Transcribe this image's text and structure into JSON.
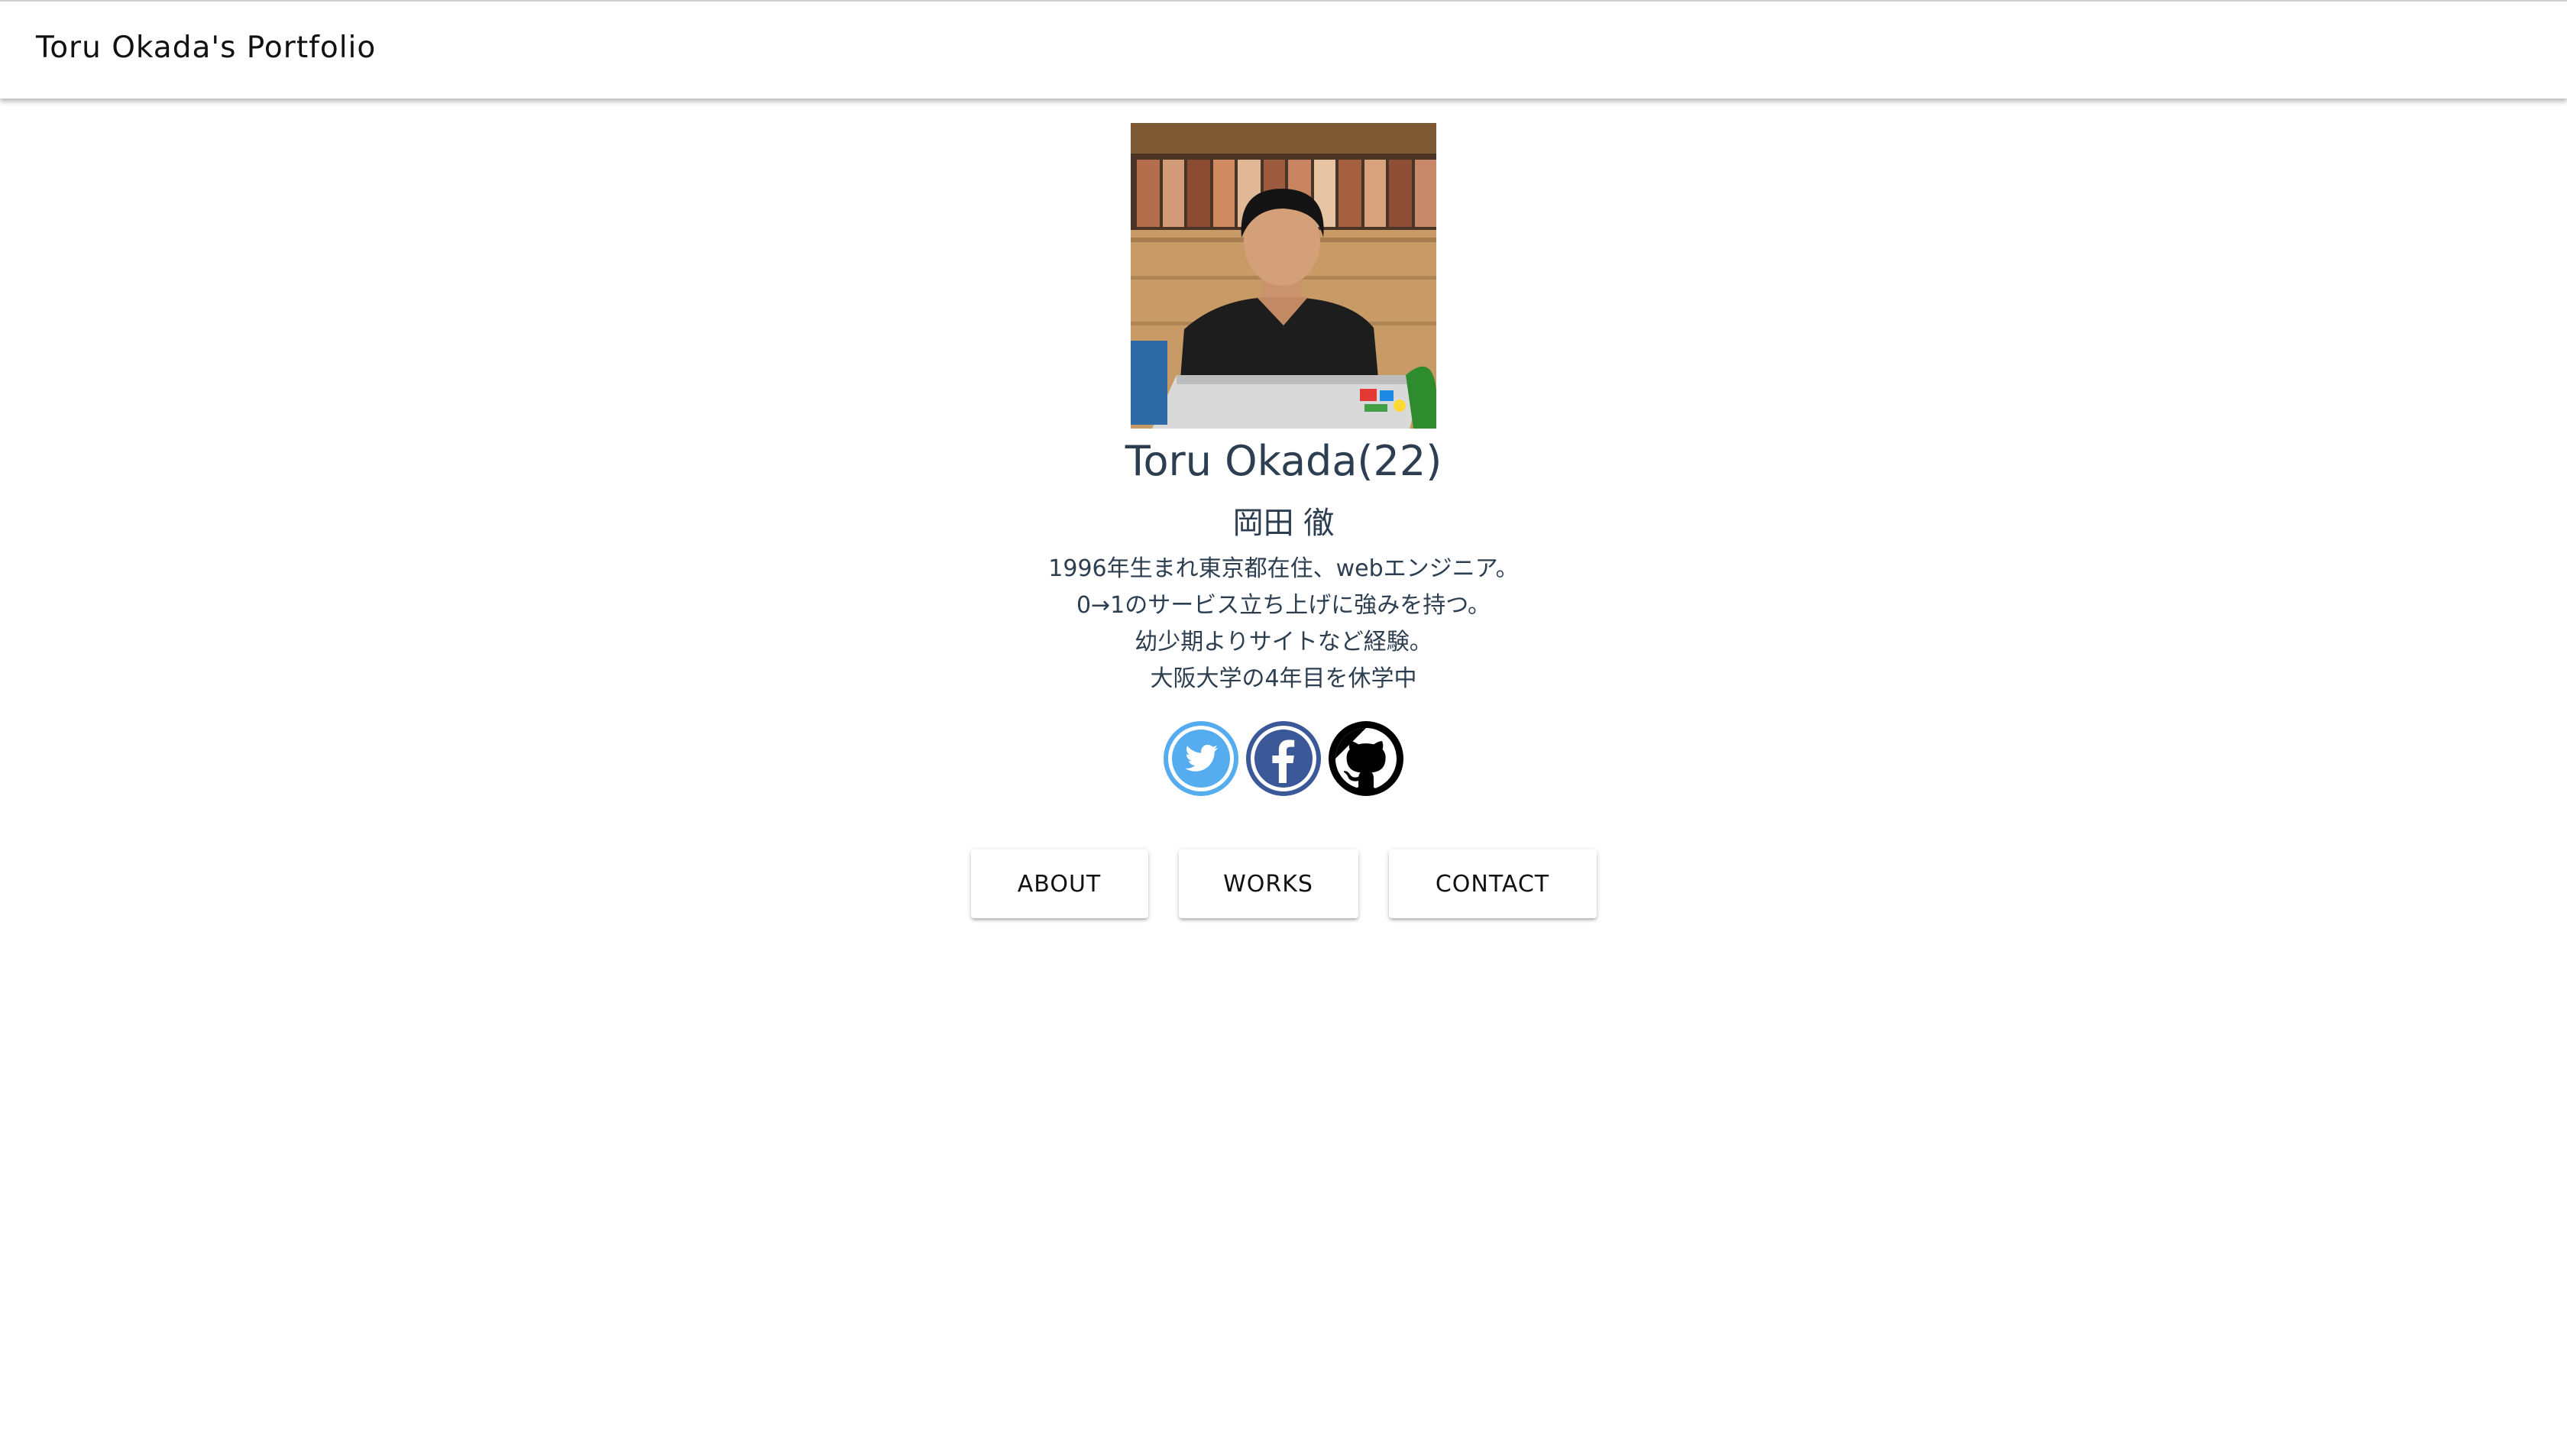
{
  "header": {
    "title": "Toru Okada's Portfolio"
  },
  "profile": {
    "photo_icon": "profile-photo",
    "name": "Toru Okada(22)",
    "name_jp": "岡田 徹",
    "bio": [
      "1996年生まれ東京都在住、webエンジニア。",
      "0→1のサービス立ち上げに強みを持つ。",
      "幼少期よりサイトなど経験。",
      "大阪大学の4年目を休学中"
    ]
  },
  "social": [
    {
      "icon": "twitter-icon",
      "color": "#55acee"
    },
    {
      "icon": "facebook-icon",
      "color": "#3b5998"
    },
    {
      "icon": "github-icon",
      "color": "#000000"
    }
  ],
  "nav": {
    "about_label": "ABOUT",
    "works_label": "WORKS",
    "contact_label": "CONTACT"
  },
  "colors": {
    "text": "#2c3e50",
    "twitter": "#55acee",
    "facebook": "#3b5998",
    "github": "#000000"
  }
}
